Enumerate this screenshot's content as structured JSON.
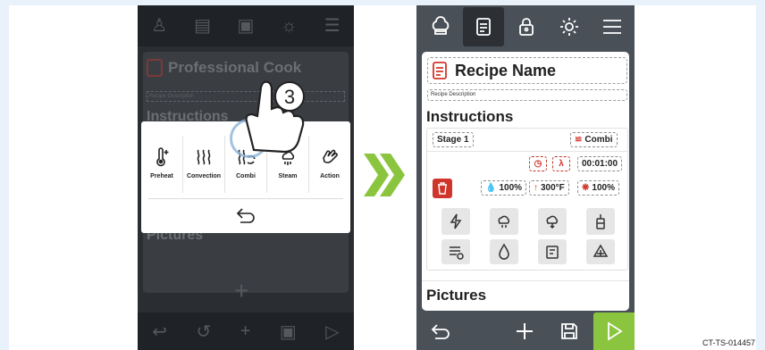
{
  "left_screen": {
    "title": "Professional Cook",
    "description_placeholder": "Recipe Description",
    "instructions_heading": "Instructions",
    "pictures_heading": "Pictures",
    "step_badge": "3",
    "popup_options": [
      {
        "label": "Preheat",
        "icon": "thermometer-icon"
      },
      {
        "label": "Convection",
        "icon": "convection-icon"
      },
      {
        "label": "Combi",
        "icon": "combi-icon"
      },
      {
        "label": "Steam",
        "icon": "steam-icon"
      },
      {
        "label": "Action",
        "icon": "hand-action-icon"
      }
    ]
  },
  "right_screen": {
    "title": "Recipe Name",
    "description_placeholder": "Recipe Description",
    "instructions_heading": "Instructions",
    "stage_label": "Stage 1",
    "mode_label": "Combi",
    "time_value": "00:01:00",
    "humidity_value": "100%",
    "temperature_value": "300°F",
    "fan_value": "100%",
    "pictures_heading": "Pictures",
    "action_grid": [
      "lightning-icon",
      "steam-inject-icon",
      "vent-icon",
      "probe-icon",
      "smoke-icon",
      "humidity-icon",
      "recipe-icon",
      "fan-icon"
    ]
  },
  "reference_code": "CT-TS-014457",
  "colors": {
    "accent_green": "#8bc53f",
    "alert_red": "#d0352b",
    "dark_bar": "#4a5058"
  }
}
